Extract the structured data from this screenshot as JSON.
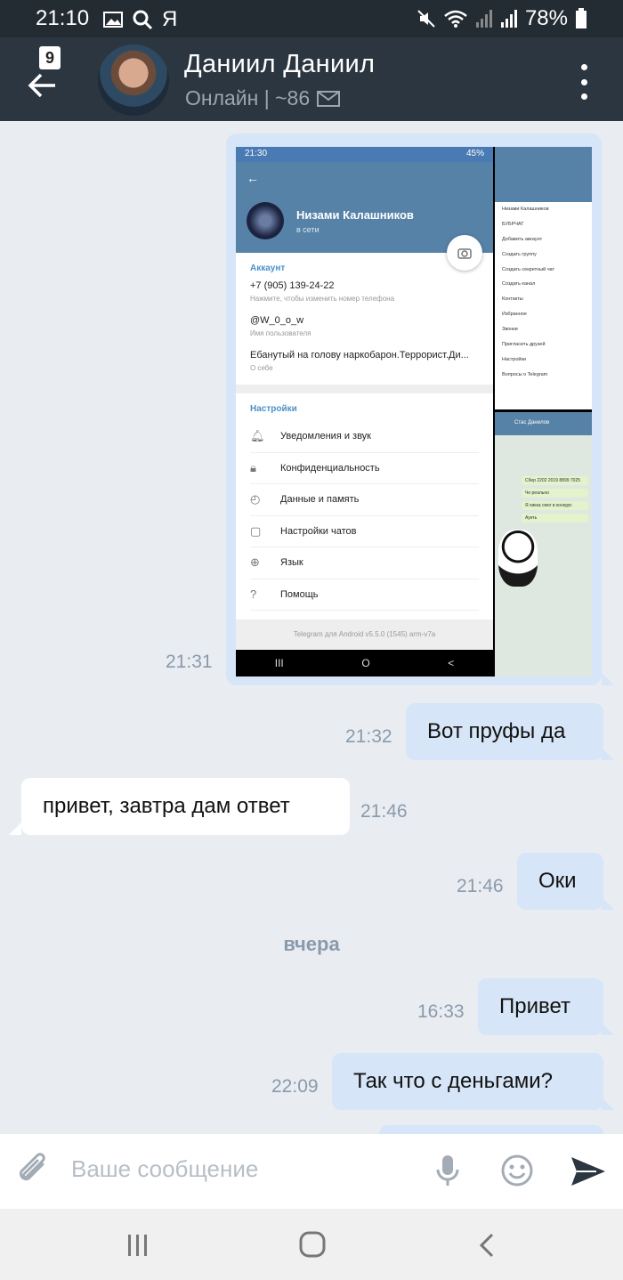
{
  "status_bar": {
    "time": "21:10",
    "extra_icon": "Я",
    "battery": "78%"
  },
  "header": {
    "unread_count": "9",
    "contact_name": "Даниил Даниил",
    "status": "Онлайн | ~86"
  },
  "photo_message": {
    "time": "21:31",
    "screenshot": {
      "status_time": "21:30",
      "status_battery": "45%",
      "profile_name": "Низами Калашников",
      "profile_status": "в сети",
      "account_section": "Аккаунт",
      "phone": "+7 (905) 139-24-22",
      "phone_hint": "Нажмите, чтобы изменить номер телефона",
      "username": "@W_0_o_w",
      "username_hint": "Имя пользователя",
      "bio": "Ебанутый на голову наркобарон.Террорист.Ди...",
      "bio_hint": "О себе",
      "settings_section": "Настройки",
      "settings": [
        "Уведомления и звук",
        "Конфиденциальность",
        "Данные и память",
        "Настройки чатов",
        "Язык",
        "Помощь"
      ],
      "footer": "Telegram для Android v5.5.0 (1545) arm-v7a",
      "menu_items": [
        "Низами Калашников",
        "БУБРЧАТ",
        "Добавить аккаунт",
        "Создать группу",
        "Создать секретный чат",
        "Создать канал",
        "Контакты",
        "Избранное",
        "Звонки",
        "Пригласить друзей",
        "Настройки",
        "Вопросы о Telegram"
      ],
      "chat_title": "Стас Данилов",
      "chat_bubbles": [
        "Сбер 2202 2019 8899 7025",
        "Че реально",
        "Я хикка смог в конкурс",
        "Ауеть"
      ]
    }
  },
  "messages": [
    {
      "text": "Вот пруфы да",
      "time": "21:32",
      "direction": "out"
    },
    {
      "text": "привет, завтра дам ответ",
      "time": "21:46",
      "direction": "in"
    },
    {
      "text": "Оки",
      "time": "21:46",
      "direction": "out"
    },
    {
      "text": "Привет",
      "time": "16:33",
      "direction": "out"
    },
    {
      "text": "Так что с деньгами?",
      "time": "22:09",
      "direction": "out"
    }
  ],
  "date_separator": "вчера",
  "composer": {
    "placeholder": "Ваше сообщение"
  },
  "colors": {
    "accent": "#2c3640",
    "bubble_out": "#d6e5f7",
    "bubble_in": "#ffffff",
    "background": "#e9edf2"
  }
}
